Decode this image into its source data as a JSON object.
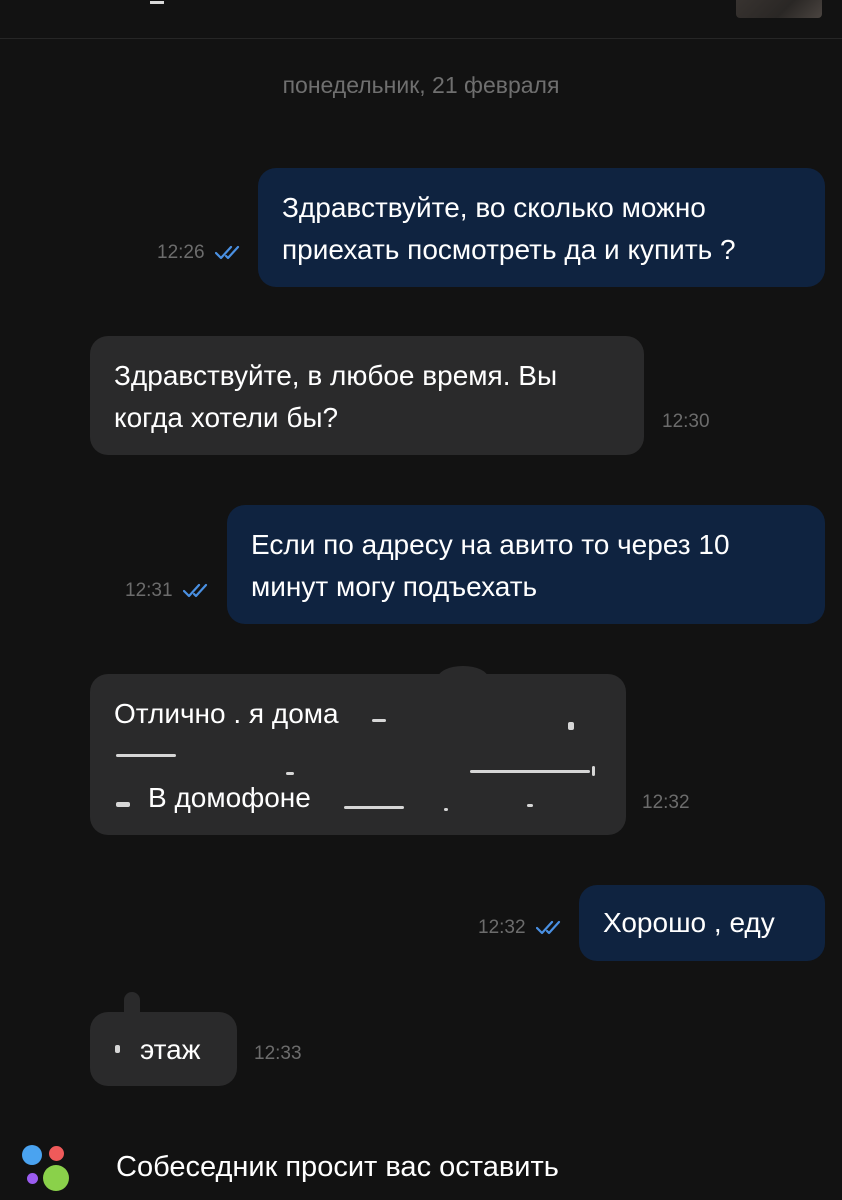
{
  "header": {
    "avatar_icon": "user-avatar-icon"
  },
  "date_separator": "понедельник, 21 февраля",
  "messages": [
    {
      "direction": "outgoing",
      "lines": [
        "Здравствуйте, во сколько можно",
        "приехать посмотреть да и купить ?"
      ],
      "time": "12:26",
      "status": "read"
    },
    {
      "direction": "incoming",
      "lines": [
        "Здравствуйте, в любое время. Вы",
        "когда хотели бы?"
      ],
      "time": "12:30"
    },
    {
      "direction": "outgoing",
      "lines": [
        "Если по адресу на авито то через 10",
        "минут могу подъехать"
      ],
      "time": "12:31",
      "status": "read"
    },
    {
      "direction": "incoming",
      "lines": [
        "Отлично . я дома",
        "",
        "В домофоне"
      ],
      "time": "12:32",
      "redacted": true
    },
    {
      "direction": "outgoing",
      "lines": [
        "Хорошо , еду"
      ],
      "time": "12:32",
      "status": "read"
    },
    {
      "direction": "incoming",
      "lines": [
        "этаж"
      ],
      "time": "12:33",
      "redacted": true
    }
  ],
  "footer": {
    "text": "Собеседник просит вас оставить",
    "logo_icon": "avito-logo-icon"
  },
  "colors": {
    "background": "#121212",
    "outgoing_bubble": "#0f2340",
    "incoming_bubble": "#2a2a2b",
    "read_ticks": "#4a90e2",
    "logo_blue": "#4aa3f0",
    "logo_red": "#ef5a5a",
    "logo_purple": "#9b5cf0",
    "logo_green": "#8ad14a"
  }
}
